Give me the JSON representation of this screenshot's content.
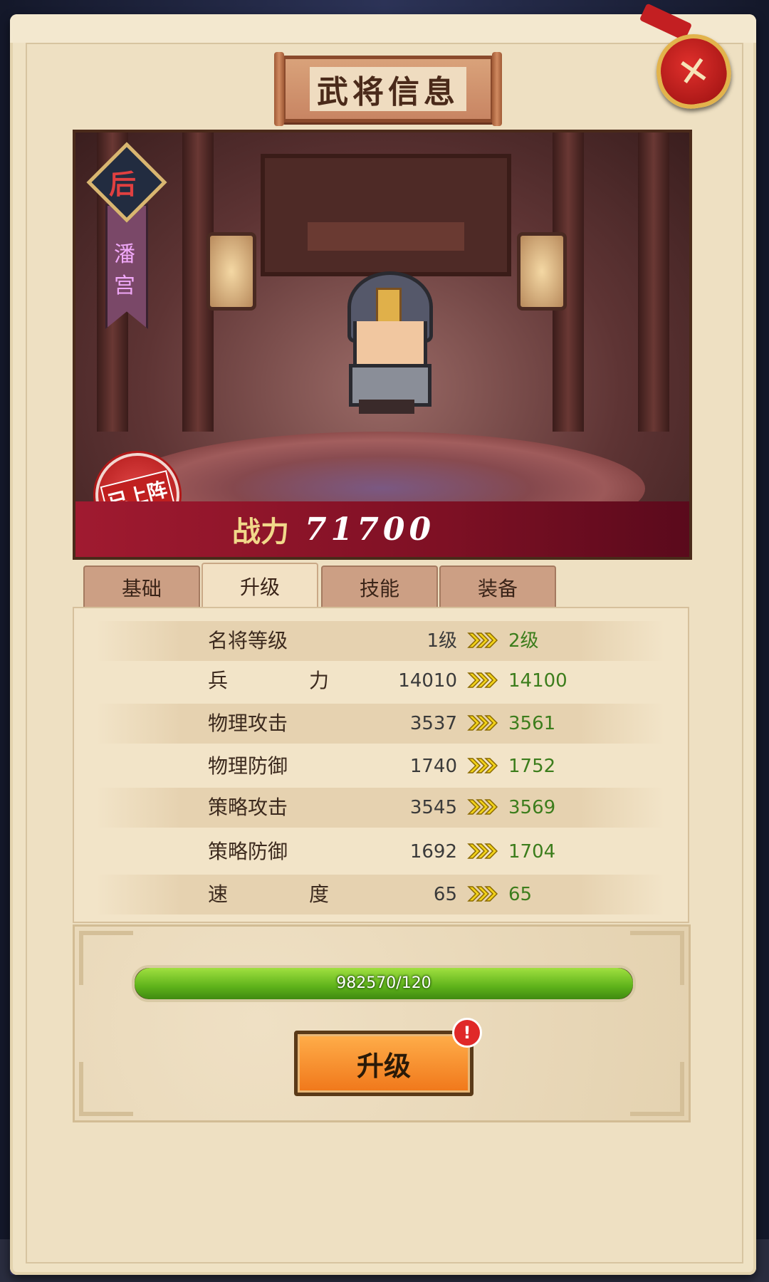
{
  "window": {
    "title": "武将信息"
  },
  "general": {
    "rank_char": "后",
    "name": "潘宫",
    "deployed_stamp": "已上阵",
    "power_label": "战力",
    "power_value": "71700"
  },
  "tabs": [
    {
      "label": "基础",
      "active": false
    },
    {
      "label": "升级",
      "active": true
    },
    {
      "label": "技能",
      "active": false
    },
    {
      "label": "装备",
      "active": false
    }
  ],
  "stats": [
    {
      "name": "名将等级",
      "old": "1级",
      "new": "2级"
    },
    {
      "name": "兵力",
      "old": "14010",
      "new": "14100"
    },
    {
      "name": "物理攻击",
      "old": "3537",
      "new": "3561"
    },
    {
      "name": "物理防御",
      "old": "1740",
      "new": "1752"
    },
    {
      "name": "策略攻击",
      "old": "3545",
      "new": "3569"
    },
    {
      "name": "策略防御",
      "old": "1692",
      "new": "1704"
    },
    {
      "name": "速度",
      "old": "65",
      "new": "65"
    }
  ],
  "exp": {
    "text": "982570/120",
    "progress": 1.0
  },
  "upgrade_button": {
    "label": "升级",
    "alert": "!"
  },
  "close_button": {
    "icon": "close-icon"
  },
  "colors": {
    "accent_green": "#3c7d1c",
    "button_orange": "#f0771a",
    "power_bar": "#a01a30"
  }
}
